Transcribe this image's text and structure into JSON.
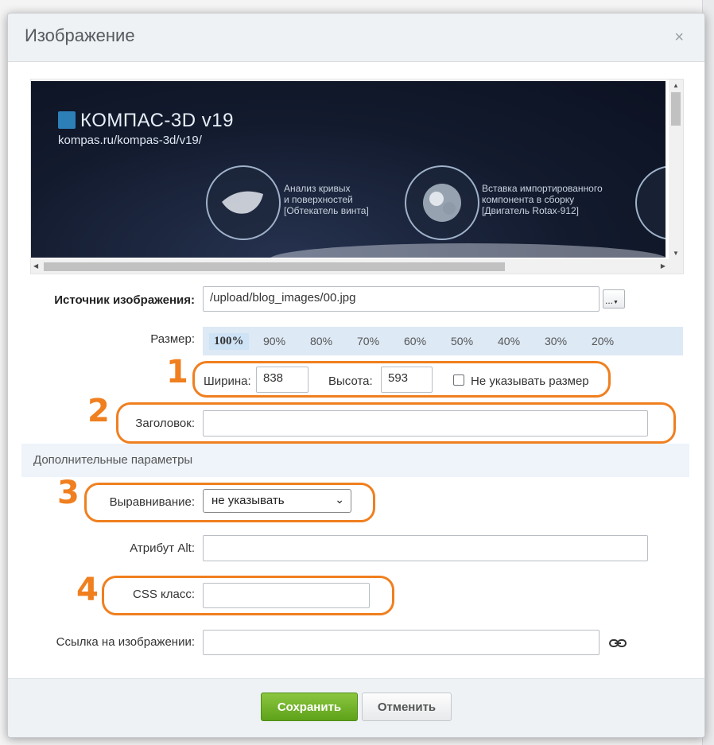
{
  "dialog": {
    "title": "Изображение",
    "close_icon": "×"
  },
  "preview": {
    "logo_text": "КОМПАС-3D v19",
    "logo_url": "kompas.ru/kompas-3d/v19/",
    "feature1": [
      "Анализ кривых",
      "и поверхностей",
      "[Обтекатель винта]"
    ],
    "feature2": [
      "Вставка импортированного",
      "компонента в сборку",
      "[Двигатель Rotax-912]"
    ]
  },
  "form": {
    "source_label": "Источник изображения:",
    "source_value": "/upload/blog_images/00.jpg",
    "browse_label": "...",
    "size_label": "Размер:",
    "sizes": [
      "100%",
      "90%",
      "80%",
      "70%",
      "60%",
      "50%",
      "40%",
      "30%",
      "20%"
    ],
    "width_label": "Ширина:",
    "width_value": "838",
    "height_label": "Высота:",
    "height_value": "593",
    "no_size_label": "Не указывать размер",
    "caption_label": "Заголовок:",
    "caption_value": "",
    "extra_params_label": "Дополнительные параметры",
    "align_label": "Выравнивание:",
    "align_value": "не указывать",
    "alt_label": "Атрибут Alt:",
    "alt_value": "",
    "css_label": "CSS класс:",
    "css_value": "",
    "link_label": "Ссылка на изображении:",
    "link_value": ""
  },
  "buttons": {
    "save": "Сохранить",
    "cancel": "Отменить"
  },
  "annotations": [
    "1",
    "2",
    "3",
    "4"
  ],
  "colors": {
    "accent_orange": "#f07f1f",
    "save_green": "#5da21a",
    "size_bar": "#dde9f5"
  }
}
